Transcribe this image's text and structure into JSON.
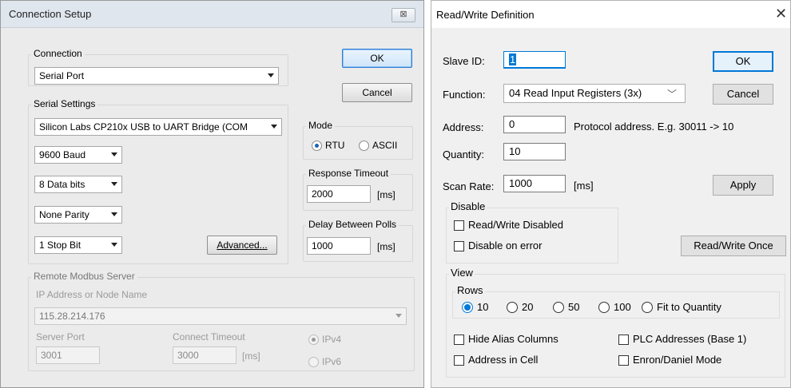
{
  "left": {
    "title": "Connection Setup",
    "close": "⊠",
    "ok": "OK",
    "cancel": "Cancel",
    "connection": {
      "label": "Connection",
      "value": "Serial Port"
    },
    "serial": {
      "label": "Serial Settings",
      "port": "Silicon Labs CP210x USB to UART Bridge (COM",
      "baud": "9600 Baud",
      "databits": "8 Data bits",
      "parity": "None Parity",
      "stopbits": "1 Stop Bit",
      "advanced": "Advanced..."
    },
    "mode": {
      "label": "Mode",
      "rtu": "RTU",
      "ascii": "ASCII",
      "selected": "RTU"
    },
    "response": {
      "label": "Response Timeout",
      "value": "2000",
      "unit": "[ms]"
    },
    "delay": {
      "label": "Delay Between Polls",
      "value": "1000",
      "unit": "[ms]"
    },
    "remote": {
      "label": "Remote Modbus Server",
      "ip_label": "IP Address or Node Name",
      "ip_value": "115.28.214.176",
      "port_label": "Server Port",
      "port_value": "3001",
      "timeout_label": "Connect Timeout",
      "timeout_value": "3000",
      "timeout_unit": "[ms]",
      "ipv4": "IPv4",
      "ipv6": "IPv6"
    }
  },
  "right": {
    "title": "Read/Write Definition",
    "close": "✕",
    "slave_label": "Slave ID:",
    "slave_value": "1",
    "function_label": "Function:",
    "function_value": "04 Read Input Registers (3x)",
    "address_label": "Address:",
    "address_value": "0",
    "address_hint": "Protocol address. E.g. 30011 -> 10",
    "quantity_label": "Quantity:",
    "quantity_value": "10",
    "scan_label": "Scan Rate:",
    "scan_value": "1000",
    "scan_unit": "[ms]",
    "ok": "OK",
    "cancel": "Cancel",
    "apply": "Apply",
    "readwrite_once": "Read/Write Once",
    "disable": {
      "label": "Disable",
      "rw_disabled": "Read/Write Disabled",
      "on_error": "Disable on error"
    },
    "view": {
      "label": "View",
      "rows_label": "Rows",
      "rows": [
        "10",
        "20",
        "50",
        "100",
        "Fit to Quantity"
      ],
      "rows_selected": "10",
      "hide_alias": "Hide Alias Columns",
      "plc_addresses": "PLC Addresses (Base 1)",
      "address_in_cell": "Address in Cell",
      "enron": "Enron/Daniel Mode"
    }
  }
}
